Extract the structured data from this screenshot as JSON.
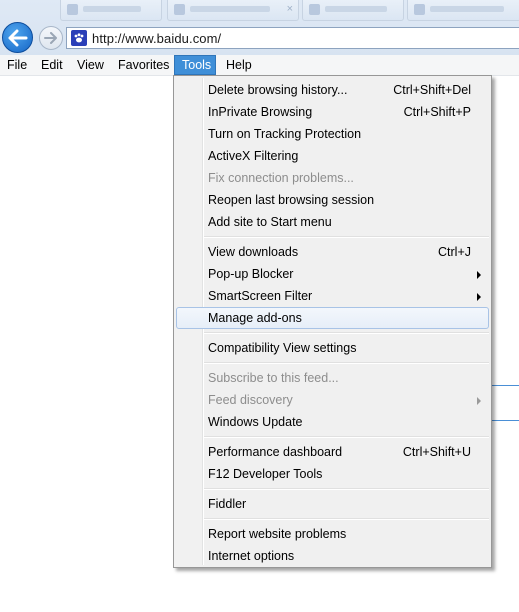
{
  "address": {
    "url": "http://www.baidu.com/"
  },
  "menubar": {
    "items": [
      {
        "label": "File"
      },
      {
        "label": "Edit"
      },
      {
        "label": "View"
      },
      {
        "label": "Favorites"
      },
      {
        "label": "Tools"
      },
      {
        "label": "Help"
      }
    ],
    "active": "Tools"
  },
  "tools_menu": {
    "groups": [
      [
        {
          "label": "Delete browsing history...",
          "shortcut": "Ctrl+Shift+Del"
        },
        {
          "label": "InPrivate Browsing",
          "shortcut": "Ctrl+Shift+P"
        },
        {
          "label": "Turn on Tracking Protection"
        },
        {
          "label": "ActiveX Filtering"
        },
        {
          "label": "Fix connection problems...",
          "disabled": true
        },
        {
          "label": "Reopen last browsing session"
        },
        {
          "label": "Add site to Start menu"
        }
      ],
      [
        {
          "label": "View downloads",
          "shortcut": "Ctrl+J"
        },
        {
          "label": "Pop-up Blocker",
          "submenu": true
        },
        {
          "label": "SmartScreen Filter",
          "submenu": true
        },
        {
          "label": "Manage add-ons",
          "highlighted": true
        }
      ],
      [
        {
          "label": "Compatibility View settings"
        }
      ],
      [
        {
          "label": "Subscribe to this feed...",
          "disabled": true
        },
        {
          "label": "Feed discovery",
          "disabled": true,
          "submenu": true
        },
        {
          "label": "Windows Update"
        }
      ],
      [
        {
          "label": "Performance dashboard",
          "shortcut": "Ctrl+Shift+U"
        },
        {
          "label": "F12 Developer Tools"
        }
      ],
      [
        {
          "label": "Fiddler"
        }
      ],
      [
        {
          "label": "Report website problems"
        },
        {
          "label": "Internet options"
        }
      ]
    ]
  },
  "colors": {
    "menu_highlight_border": "#a8c3e6",
    "menubar_active": "#3f8fd8",
    "back_button": "#1f78d8"
  }
}
